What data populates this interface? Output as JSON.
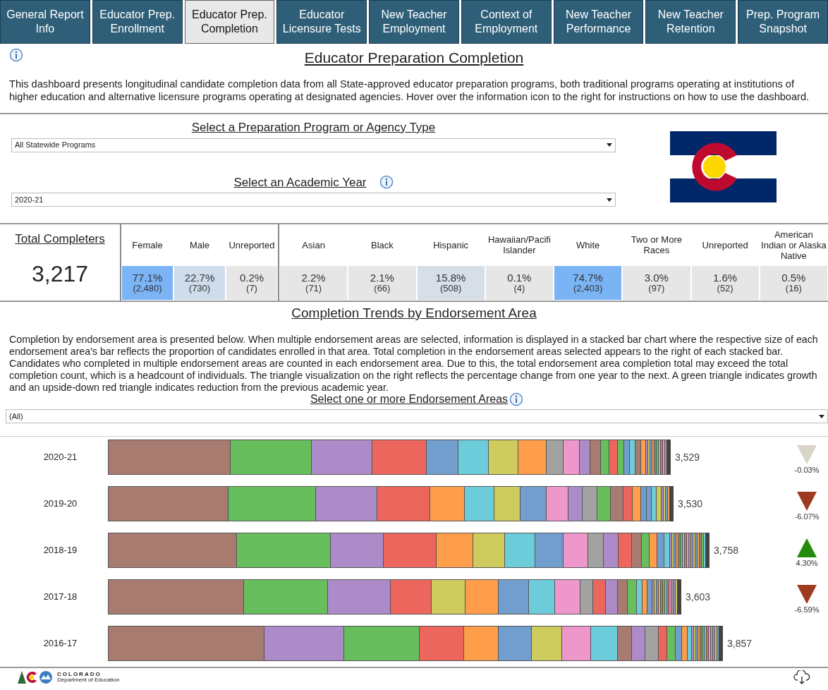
{
  "tabs": [
    {
      "label": "General Report Info",
      "selected": false
    },
    {
      "label": "Educator Prep. Enrollment",
      "selected": false
    },
    {
      "label": "Educator Prep. Completion",
      "selected": true
    },
    {
      "label": "Educator Licensure Tests",
      "selected": false
    },
    {
      "label": "New Teacher Employment",
      "selected": false
    },
    {
      "label": "Context of Employment",
      "selected": false
    },
    {
      "label": "New Teacher Performance",
      "selected": false
    },
    {
      "label": "New Teacher Retention",
      "selected": false
    },
    {
      "label": "Prep. Program Snapshot",
      "selected": false
    }
  ],
  "title": "Educator Preparation Completion",
  "description": "This dashboard presents longitudinal candidate completion data from all State-approved educator preparation programs, both traditional programs operating at institutions of higher education and alternative licensure programs operating at designated agencies. Hover over the information icon to the right for instructions on how to use the dashboard.",
  "program_select": {
    "label": "Select a Preparation Program or Agency Type",
    "value": "All Statewide Programs"
  },
  "year_select": {
    "label": "Select an Academic Year",
    "value": "2020-21"
  },
  "completers": {
    "label": "Total Completers",
    "value": "3,217"
  },
  "demographics": [
    {
      "columns": [
        {
          "header": "Female",
          "percent": "77.1%",
          "count": "(2,480)",
          "color": "#7ab4f5"
        },
        {
          "header": "Male",
          "percent": "22.7%",
          "count": "(730)",
          "color": "#cfdcec"
        },
        {
          "header": "Unreported",
          "percent": "0.2%",
          "count": "(7)",
          "color": "#e6e6e6"
        }
      ]
    },
    {
      "columns": [
        {
          "header": "Asian",
          "percent": "2.2%",
          "count": "(71)",
          "color": "#e6e6e6"
        },
        {
          "header": "Black",
          "percent": "2.1%",
          "count": "(66)",
          "color": "#e6e6e6"
        },
        {
          "header": "Hispanic",
          "percent": "15.8%",
          "count": "(508)",
          "color": "#d6dee8"
        },
        {
          "header": "Hawaiian/Pacifi\nIslander",
          "percent": "0.1%",
          "count": "(4)",
          "color": "#e6e6e6"
        },
        {
          "header": "White",
          "percent": "74.7%",
          "count": "(2,403)",
          "color": "#7ab4f5"
        },
        {
          "header": "Two or More Races",
          "percent": "3.0%",
          "count": "(97)",
          "color": "#e6e6e6"
        },
        {
          "header": "Unreported",
          "percent": "1.6%",
          "count": "(52)",
          "color": "#e6e6e6"
        },
        {
          "header": "American Indian or Alaska Native",
          "percent": "0.5%",
          "count": "(16)",
          "color": "#e6e6e6"
        }
      ]
    }
  ],
  "endorsement": {
    "title": "Completion Trends by Endorsement Area",
    "description": "Completion by endorsement area is presented below. When multiple endorsement areas are selected, information is displayed in a stacked bar chart where the respective size of each endorsement area's bar reflects the proportion of candidates enrolled in that area. Total completion in the endorsement areas selected appears to the right of each stacked bar. Candidates who completed in multiple endorsement areas are counted in each endorsement area. Due to this, the total endorsement area completion total may exceed the total completion count, which is a headcount of individuals. The triangle visualization on the right reflects the percentage change from one year to the next. A green triangle indicates growth and an upside-down red triangle indicates reduction from the previous academic year.",
    "select": {
      "label": "Select one or more Endorsement Areas",
      "value": "(All)"
    },
    "rows": [
      {
        "year": "2020-21",
        "total": "3,529",
        "change": "-0.03%",
        "kind": "flat"
      },
      {
        "year": "2019-20",
        "total": "3,530",
        "change": "-6.07%",
        "kind": "down"
      },
      {
        "year": "2018-19",
        "total": "3,758",
        "change": "4.30%",
        "kind": "up"
      },
      {
        "year": "2017-18",
        "total": "3,603",
        "change": "-6.59%",
        "kind": "down"
      },
      {
        "year": "2016-17",
        "total": "3,857"
      }
    ]
  },
  "footer": {
    "logo_text": "COLORADO",
    "logo_subtext": "Department of Education"
  }
}
